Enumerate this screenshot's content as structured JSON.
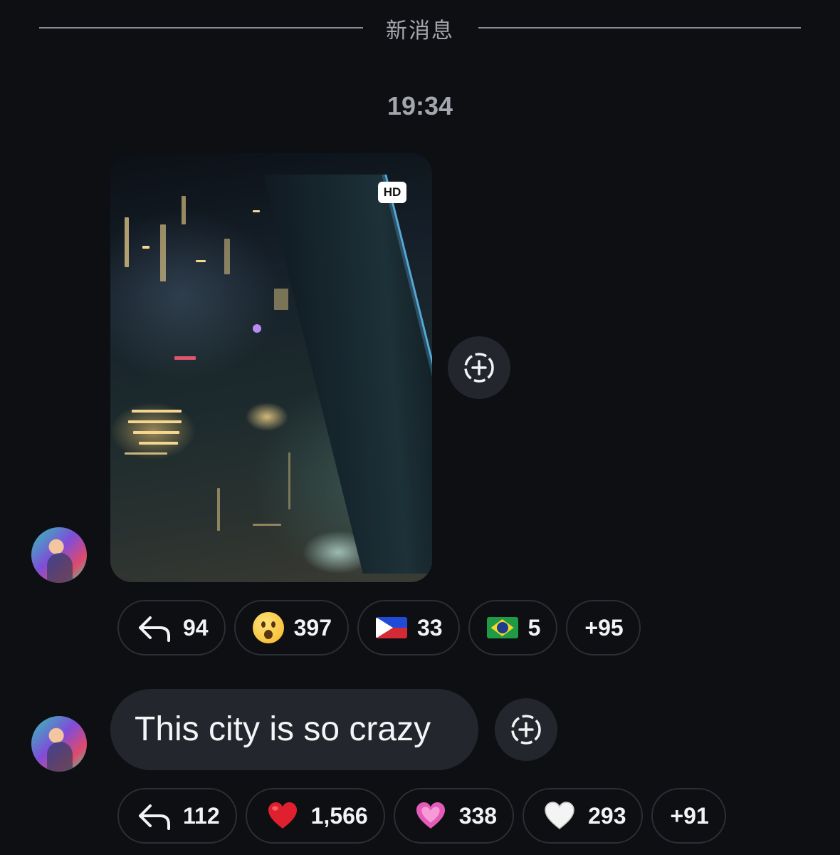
{
  "divider": {
    "label": "新消息"
  },
  "timestamp": "19:34",
  "messages": [
    {
      "type": "photo",
      "badge": "HD",
      "reactions": [
        {
          "kind": "reply",
          "icon": "reply-arrow-icon",
          "count": "94"
        },
        {
          "kind": "emoji",
          "icon": "astonished-face-emoji",
          "count": "397"
        },
        {
          "kind": "emoji",
          "icon": "philippines-flag-emoji",
          "count": "33"
        },
        {
          "kind": "emoji",
          "icon": "brazil-flag-emoji",
          "count": "5"
        },
        {
          "kind": "more",
          "count": "+95"
        }
      ]
    },
    {
      "type": "text",
      "text": "This city is so crazy",
      "reactions": [
        {
          "kind": "reply",
          "icon": "reply-arrow-icon",
          "count": "112"
        },
        {
          "kind": "emoji",
          "icon": "red-heart-emoji",
          "count": "1,566"
        },
        {
          "kind": "emoji",
          "icon": "pink-sparkling-heart-emoji",
          "count": "338"
        },
        {
          "kind": "emoji",
          "icon": "white-heart-emoji",
          "count": "293"
        },
        {
          "kind": "more",
          "count": "+91"
        }
      ]
    }
  ],
  "colors": {
    "background": "#0e0f13",
    "bubble": "#23262c",
    "muted_text": "#a4a7ad",
    "chip_border": "#2b2e34"
  }
}
